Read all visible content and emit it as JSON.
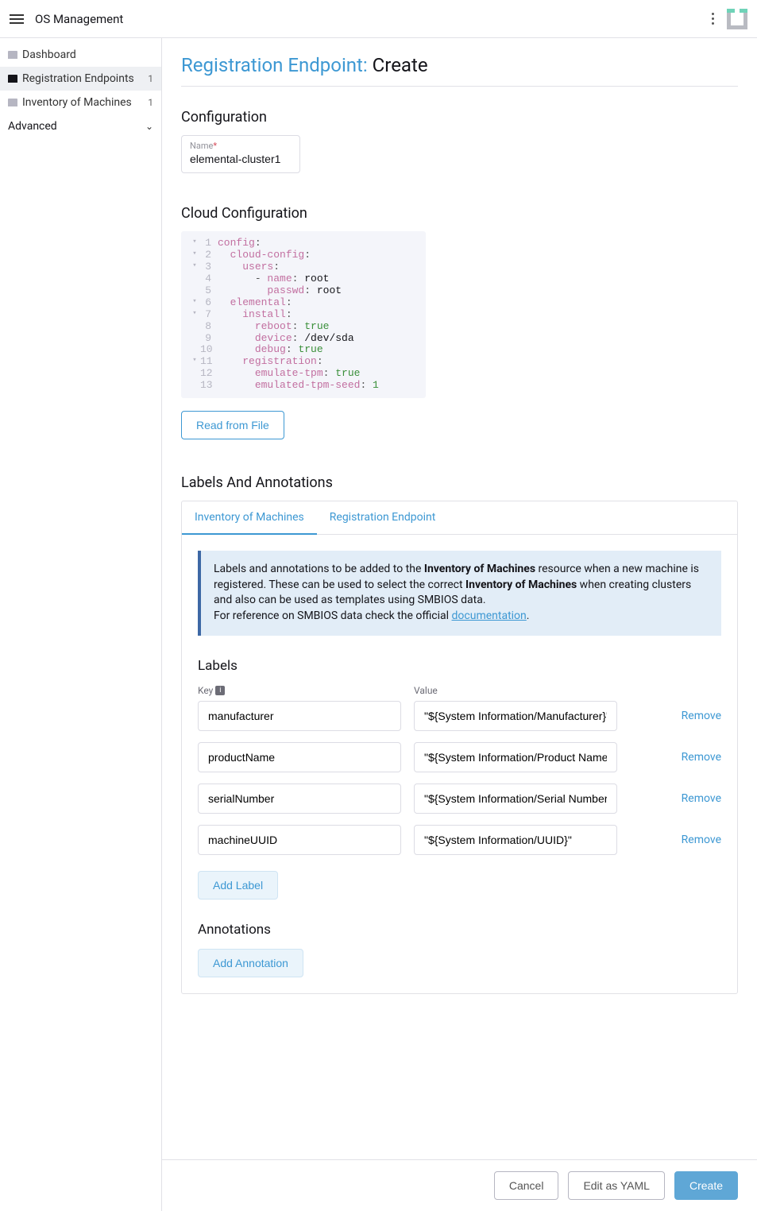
{
  "topbar": {
    "title": "OS Management"
  },
  "sidebar": {
    "items": [
      {
        "label": "Dashboard",
        "count": ""
      },
      {
        "label": "Registration Endpoints",
        "count": "1"
      },
      {
        "label": "Inventory of Machines",
        "count": "1"
      }
    ],
    "advanced": "Advanced"
  },
  "page": {
    "breadcrumb": "Registration Endpoint:",
    "title_action": "Create"
  },
  "config": {
    "heading": "Configuration",
    "name_label": "Name",
    "name_value": "elemental-cluster1"
  },
  "cloud": {
    "heading": "Cloud Configuration",
    "read_file": "Read from File",
    "lines": [
      {
        "n": "1",
        "fold": "▾",
        "segs": [
          [
            "config",
            "k"
          ],
          [
            ":",
            "p"
          ]
        ]
      },
      {
        "n": "2",
        "fold": "▾",
        "segs": [
          [
            "  ",
            ""
          ],
          [
            "cloud-config",
            "k"
          ],
          [
            ":",
            "p"
          ]
        ]
      },
      {
        "n": "3",
        "fold": "▾",
        "segs": [
          [
            "    ",
            ""
          ],
          [
            "users",
            "k"
          ],
          [
            ":",
            "p"
          ]
        ]
      },
      {
        "n": "4",
        "fold": "",
        "segs": [
          [
            "      ",
            ""
          ],
          [
            "- ",
            "p"
          ],
          [
            "name",
            "k"
          ],
          [
            ": ",
            "p"
          ],
          [
            "root",
            "v"
          ]
        ]
      },
      {
        "n": "5",
        "fold": "",
        "segs": [
          [
            "        ",
            ""
          ],
          [
            "passwd",
            "k"
          ],
          [
            ": ",
            "p"
          ],
          [
            "root",
            "v"
          ]
        ]
      },
      {
        "n": "6",
        "fold": "▾",
        "segs": [
          [
            "  ",
            ""
          ],
          [
            "elemental",
            "k"
          ],
          [
            ":",
            "p"
          ]
        ]
      },
      {
        "n": "7",
        "fold": "▾",
        "segs": [
          [
            "    ",
            ""
          ],
          [
            "install",
            "k"
          ],
          [
            ":",
            "p"
          ]
        ]
      },
      {
        "n": "8",
        "fold": "",
        "segs": [
          [
            "      ",
            ""
          ],
          [
            "reboot",
            "k"
          ],
          [
            ": ",
            "p"
          ],
          [
            "true",
            "n"
          ]
        ]
      },
      {
        "n": "9",
        "fold": "",
        "segs": [
          [
            "      ",
            ""
          ],
          [
            "device",
            "k"
          ],
          [
            ": ",
            "p"
          ],
          [
            "/dev/sda",
            "v"
          ]
        ]
      },
      {
        "n": "10",
        "fold": "",
        "segs": [
          [
            "      ",
            ""
          ],
          [
            "debug",
            "k"
          ],
          [
            ": ",
            "p"
          ],
          [
            "true",
            "n"
          ]
        ]
      },
      {
        "n": "11",
        "fold": "▾",
        "segs": [
          [
            "    ",
            ""
          ],
          [
            "registration",
            "k"
          ],
          [
            ":",
            "p"
          ]
        ]
      },
      {
        "n": "12",
        "fold": "",
        "segs": [
          [
            "      ",
            ""
          ],
          [
            "emulate-tpm",
            "k"
          ],
          [
            ": ",
            "p"
          ],
          [
            "true",
            "n"
          ]
        ]
      },
      {
        "n": "13",
        "fold": "",
        "segs": [
          [
            "      ",
            ""
          ],
          [
            "emulated-tpm-seed",
            "k"
          ],
          [
            ": ",
            "p"
          ],
          [
            "1",
            "n"
          ]
        ]
      }
    ]
  },
  "la": {
    "heading": "Labels And Annotations",
    "tab1": "Inventory of Machines",
    "tab2": "Registration Endpoint",
    "banner_p1": "Labels and annotations to be added to the ",
    "banner_b1": "Inventory of Machines",
    "banner_p2": " resource when a new machine is registered. These can be used to select the correct ",
    "banner_b2": "Inventory of Machines",
    "banner_p3": " when creating clusters and also can be used as templates using SMBIOS data.",
    "banner_p4": "For reference on SMBIOS data check the official ",
    "banner_link": "documentation",
    "labels_h": "Labels",
    "key_h": "Key",
    "value_h": "Value",
    "rows": [
      {
        "k": "manufacturer",
        "v": "\"${System Information/Manufacturer}\""
      },
      {
        "k": "productName",
        "v": "\"${System Information/Product Name}\""
      },
      {
        "k": "serialNumber",
        "v": "\"${System Information/Serial Number}\""
      },
      {
        "k": "machineUUID",
        "v": "\"${System Information/UUID}\""
      }
    ],
    "remove": "Remove",
    "add_label": "Add Label",
    "annotations_h": "Annotations",
    "add_annotation": "Add Annotation"
  },
  "footer": {
    "cancel": "Cancel",
    "edit_yaml": "Edit as YAML",
    "create": "Create"
  }
}
